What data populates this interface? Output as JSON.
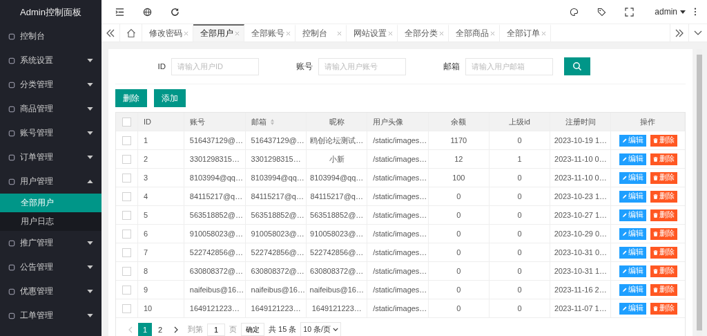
{
  "sidebar": {
    "title": "Admin控制面板",
    "items": [
      {
        "label": "控制台"
      },
      {
        "label": "系统设置",
        "expanded": false
      },
      {
        "label": "分类管理",
        "expanded": false
      },
      {
        "label": "商品管理",
        "expanded": false
      },
      {
        "label": "账号管理",
        "expanded": false
      },
      {
        "label": "订单管理",
        "expanded": false
      },
      {
        "label": "用户管理",
        "expanded": true,
        "children": [
          {
            "label": "全部用户",
            "selected": true
          },
          {
            "label": "用户日志",
            "selected": false
          }
        ]
      },
      {
        "label": "推广管理",
        "expanded": false
      },
      {
        "label": "公告管理",
        "expanded": false
      },
      {
        "label": "优惠管理",
        "expanded": false
      },
      {
        "label": "工单管理",
        "expanded": false
      }
    ]
  },
  "topbar": {
    "user": "admin"
  },
  "tabs": [
    {
      "label": "修改密码",
      "selected": false
    },
    {
      "label": "全部用户",
      "selected": true
    },
    {
      "label": "全部账号",
      "selected": false
    },
    {
      "label": "控制台",
      "selected": false
    },
    {
      "label": "网站设置",
      "selected": false
    },
    {
      "label": "全部分类",
      "selected": false
    },
    {
      "label": "全部商品",
      "selected": false
    },
    {
      "label": "全部订单",
      "selected": false
    }
  ],
  "search": {
    "fields": [
      {
        "label": "ID",
        "placeholder": "请输入用户ID"
      },
      {
        "label": "账号",
        "placeholder": "请输入用户账号"
      },
      {
        "label": "邮箱",
        "placeholder": "请输入用户邮箱"
      }
    ]
  },
  "actions": [
    "删除",
    "添加"
  ],
  "table": {
    "select_all_checked": false,
    "columns": [
      {
        "label": "ID"
      },
      {
        "label": "账号"
      },
      {
        "label": "邮箱",
        "sortable": true
      },
      {
        "label": "昵称"
      },
      {
        "label": "用户头像"
      },
      {
        "label": "余额"
      },
      {
        "label": "上级id"
      },
      {
        "label": "注册时间"
      },
      {
        "label": "操作"
      }
    ],
    "rows": [
      {
        "checked": false,
        "actions": [
          "编辑",
          "删除"
        ],
        "cells": [
          "1",
          "516437129@…",
          "516437129@…",
          "鸥创论坛测试…",
          "/static/images…",
          "1170",
          "0",
          "2023-10-19 1…"
        ]
      },
      {
        "checked": false,
        "actions": [
          "编辑",
          "删除"
        ],
        "cells": [
          "2",
          "3301298315…",
          "3301298315…",
          "小新",
          "/static/images…",
          "12",
          "1",
          "2023-11-10 0…"
        ]
      },
      {
        "checked": false,
        "actions": [
          "编辑",
          "删除"
        ],
        "cells": [
          "3",
          "8103994@qq…",
          "8103994@qq…",
          "8103994@qq…",
          "/static/images…",
          "100",
          "0",
          "2023-11-10 0…"
        ]
      },
      {
        "checked": false,
        "actions": [
          "编辑",
          "删除"
        ],
        "cells": [
          "4",
          "84115217@q…",
          "84115217@q…",
          "84115217@q…",
          "/static/images…",
          "0",
          "0",
          "2023-10-23 1…"
        ]
      },
      {
        "checked": false,
        "actions": [
          "编辑",
          "删除"
        ],
        "cells": [
          "5",
          "563518852@…",
          "563518852@…",
          "563518852@…",
          "/static/images…",
          "0",
          "0",
          "2023-10-27 1…"
        ]
      },
      {
        "checked": false,
        "actions": [
          "编辑",
          "删除"
        ],
        "cells": [
          "6",
          "910058023@…",
          "910058023@…",
          "910058023@…",
          "/static/images…",
          "0",
          "0",
          "2023-10-29 0…"
        ]
      },
      {
        "checked": false,
        "actions": [
          "编辑",
          "删除"
        ],
        "cells": [
          "7",
          "522742856@…",
          "522742856@…",
          "522742856@…",
          "/static/images…",
          "0",
          "0",
          "2023-10-31 0…"
        ]
      },
      {
        "checked": false,
        "actions": [
          "编辑",
          "删除"
        ],
        "cells": [
          "8",
          "630808372@…",
          "630808372@…",
          "630808372@…",
          "/static/images…",
          "0",
          "0",
          "2023-10-31 1…"
        ]
      },
      {
        "checked": false,
        "actions": [
          "编辑",
          "删除"
        ],
        "cells": [
          "9",
          "naifeibus@16…",
          "naifeibus@16…",
          "naifeibus@16…",
          "/static/images…",
          "0",
          "0",
          "2023-11-16 2…"
        ]
      },
      {
        "checked": false,
        "actions": [
          "编辑",
          "删除"
        ],
        "cells": [
          "10",
          "1649121223…",
          "1649121223…",
          "1649121223…",
          "/static/images…",
          "0",
          "0",
          "2023-11-07 1…"
        ]
      }
    ]
  },
  "pagination": {
    "pages": [
      {
        "label": "1",
        "selected": true
      },
      {
        "label": "2",
        "selected": false
      }
    ],
    "goto_label": "到第",
    "goto_value": "1",
    "page_unit": "页",
    "confirm": "确定",
    "total": "共 15 条",
    "page_size": "10 条/页"
  }
}
